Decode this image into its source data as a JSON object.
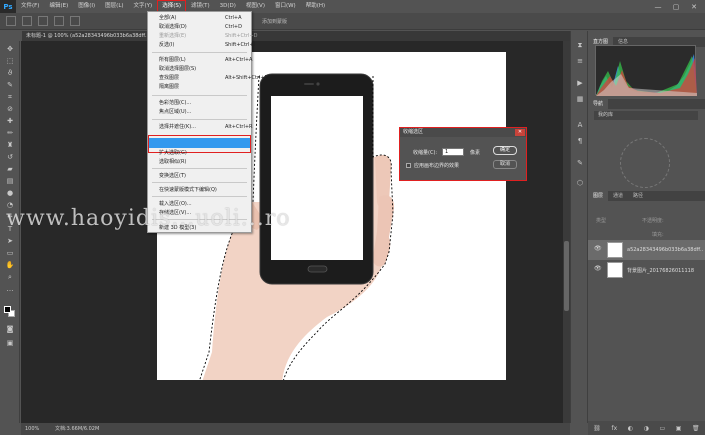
{
  "menubar": {
    "logo": "Ps",
    "items": [
      "文件(F)",
      "编辑(E)",
      "图像(I)",
      "图层(L)",
      "文字(Y)",
      "选择(S)",
      "滤镜(T)",
      "3D(D)",
      "视图(V)",
      "窗口(W)",
      "帮助(H)"
    ],
    "active_index": 5,
    "window_controls": [
      "—",
      "▢",
      "✕"
    ]
  },
  "options_bar": {
    "text": "添加到蒙版"
  },
  "document": {
    "tab_title": "未标题-1 @ 100% (a52a28343496b033b6a38dff..."
  },
  "select_menu": {
    "items": [
      {
        "label": "全部(A)",
        "shortcut": "Ctrl+A",
        "disabled": false
      },
      {
        "label": "取消选择(D)",
        "shortcut": "Ctrl+D",
        "disabled": false
      },
      {
        "label": "重新选择(E)",
        "shortcut": "Shift+Ctrl+D",
        "disabled": true
      },
      {
        "label": "反选(I)",
        "shortcut": "Shift+Ctrl+I",
        "disabled": false
      },
      {
        "label": "所有图层(L)",
        "shortcut": "Alt+Ctrl+A",
        "disabled": false
      },
      {
        "label": "取消选择图层(S)",
        "shortcut": "",
        "disabled": false
      },
      {
        "label": "查找图层",
        "shortcut": "Alt+Shift+Ctrl+F",
        "disabled": false
      },
      {
        "label": "隔离图层",
        "shortcut": "",
        "disabled": false
      },
      {
        "label": "色彩范围(C)...",
        "shortcut": "",
        "disabled": false
      },
      {
        "label": "焦点区域(U)...",
        "shortcut": "",
        "disabled": false
      },
      {
        "label": "选择并遮住(K)...",
        "shortcut": "Alt+Ctrl+R",
        "disabled": false
      },
      {
        "label": "扩大选取(G)",
        "shortcut": "",
        "disabled": false
      },
      {
        "label": "选取相似(R)",
        "shortcut": "",
        "disabled": false
      },
      {
        "label": "变换选区(T)",
        "shortcut": "",
        "disabled": false
      },
      {
        "label": "在快速蒙版模式下编辑(Q)",
        "shortcut": "",
        "disabled": false
      },
      {
        "label": "载入选区(O)...",
        "shortcut": "",
        "disabled": false
      },
      {
        "label": "存储选区(V)...",
        "shortcut": "",
        "disabled": false
      },
      {
        "label": "新建 3D 模型(3)",
        "shortcut": "",
        "disabled": false
      }
    ]
  },
  "shrink_dialog": {
    "title": "收缩选区",
    "close": "✕",
    "amount_label": "收缩量(C):",
    "amount_value": "1",
    "unit": "像素",
    "apply_edge_label": "应用画布边界的效果",
    "ok_label": "确定",
    "cancel_label": "取消"
  },
  "panels": {
    "top_tabs": [
      "直方图",
      "信息"
    ],
    "mid_tabs": [
      "导航"
    ],
    "adj_label": "我的库",
    "layer_tabs": [
      "图层",
      "通道",
      "路径"
    ],
    "layer_row_labels": [
      "类型",
      "不透明度:",
      "填充:"
    ],
    "layers": [
      {
        "name": "a52a28343496b033b6a38dff...",
        "selected": true
      },
      {
        "name": "背景图片_20176826011118",
        "selected": false
      }
    ],
    "bottom_icons": [
      "⛓",
      "fx",
      "◐",
      "◑",
      "▭",
      "▣",
      "🗑"
    ]
  },
  "status_bar": {
    "zoom": "100%",
    "doc": "文档:3.66M/6.02M"
  },
  "watermark": "www.haoyidis...uoli...ro",
  "colors": {
    "accent_red": "#e02020",
    "menu_highlight": "#3399ee",
    "canvas_bg": "#282828"
  }
}
